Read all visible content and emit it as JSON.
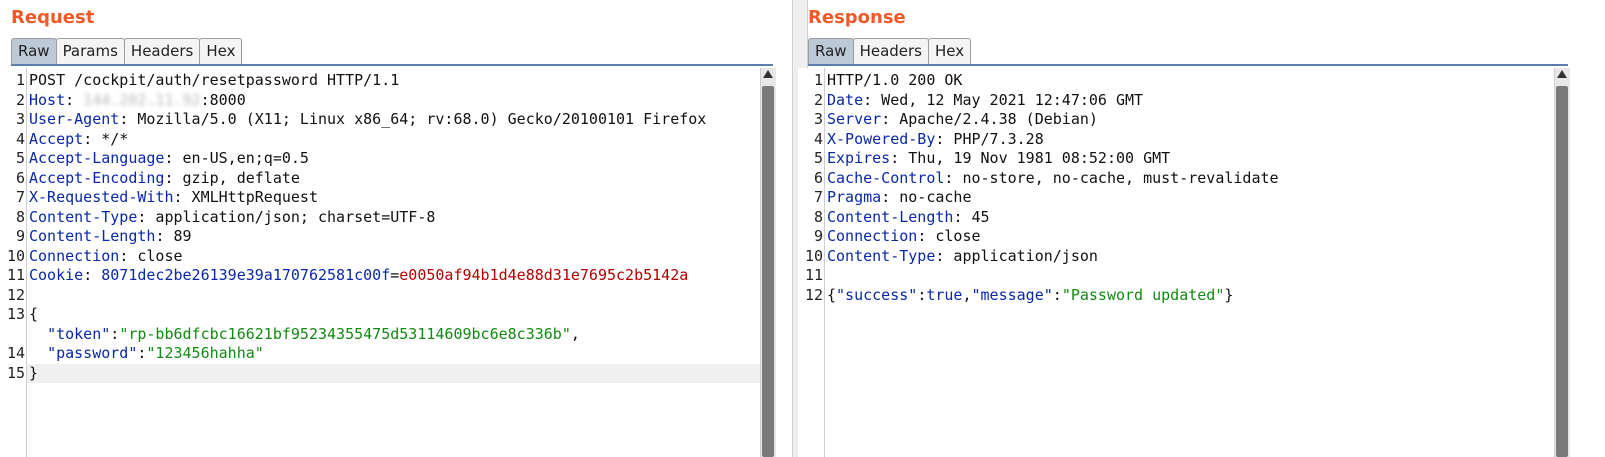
{
  "request": {
    "title": "Request",
    "tabs": [
      "Raw",
      "Params",
      "Headers",
      "Hex"
    ],
    "lines": [
      {
        "n": "1",
        "parts": [
          {
            "t": "POST /cockpit/auth/resetpassword HTTP/1.1",
            "c": ""
          }
        ]
      },
      {
        "n": "2",
        "parts": [
          {
            "t": "Host",
            "c": "k"
          },
          {
            "t": ": ",
            "c": ""
          },
          {
            "t": "144.202.11.92",
            "c": "ip"
          },
          {
            "t": ":8000",
            "c": ""
          }
        ]
      },
      {
        "n": "3",
        "parts": [
          {
            "t": "User-Agent",
            "c": "k"
          },
          {
            "t": ": Mozilla/5.0 (X11; Linux x86_64; rv:68.0) Gecko/20100101 Firefox",
            "c": ""
          }
        ]
      },
      {
        "n": "4",
        "parts": [
          {
            "t": "Accept",
            "c": "k"
          },
          {
            "t": ": */*",
            "c": ""
          }
        ]
      },
      {
        "n": "5",
        "parts": [
          {
            "t": "Accept-Language",
            "c": "k"
          },
          {
            "t": ": en-US,en;q=0.5",
            "c": ""
          }
        ]
      },
      {
        "n": "6",
        "parts": [
          {
            "t": "Accept-Encoding",
            "c": "k"
          },
          {
            "t": ": gzip, deflate",
            "c": ""
          }
        ]
      },
      {
        "n": "7",
        "parts": [
          {
            "t": "X-Requested-With",
            "c": "k"
          },
          {
            "t": ": XMLHttpRequest",
            "c": ""
          }
        ]
      },
      {
        "n": "8",
        "parts": [
          {
            "t": "Content-Type",
            "c": "k"
          },
          {
            "t": ": application/json; charset=UTF-8",
            "c": ""
          }
        ]
      },
      {
        "n": "9",
        "parts": [
          {
            "t": "Content-Length",
            "c": "k"
          },
          {
            "t": ": 89",
            "c": ""
          }
        ]
      },
      {
        "n": "10",
        "parts": [
          {
            "t": "Connection",
            "c": "k"
          },
          {
            "t": ": close",
            "c": ""
          }
        ]
      },
      {
        "n": "11",
        "parts": [
          {
            "t": "Cookie",
            "c": "k"
          },
          {
            "t": ": ",
            "c": ""
          },
          {
            "t": "8071dec2be26139e39a170762581c00f",
            "c": "k"
          },
          {
            "t": "=",
            "c": ""
          },
          {
            "t": "e0050af94b1d4e88d31e7695c2b5142a",
            "c": "cv"
          }
        ]
      },
      {
        "n": "12",
        "parts": []
      },
      {
        "n": "13",
        "parts": [
          {
            "t": "{",
            "c": ""
          }
        ]
      },
      {
        "n": "",
        "parts": [
          {
            "t": "  ",
            "c": ""
          },
          {
            "t": "\"token\"",
            "c": "k"
          },
          {
            "t": ":",
            "c": ""
          },
          {
            "t": "\"rp-bb6dfcbc16621bf95234355475d53114609bc6e8c336b\"",
            "c": "str"
          },
          {
            "t": ",",
            "c": ""
          }
        ]
      },
      {
        "n": "14",
        "parts": [
          {
            "t": "  ",
            "c": ""
          },
          {
            "t": "\"password\"",
            "c": "k"
          },
          {
            "t": ":",
            "c": ""
          },
          {
            "t": "\"123456hahha\"",
            "c": "str"
          }
        ]
      },
      {
        "n": "15",
        "parts": [
          {
            "t": "}",
            "c": ""
          }
        ]
      }
    ],
    "highlight_line": 15
  },
  "response": {
    "title": "Response",
    "tabs": [
      "Raw",
      "Headers",
      "Hex"
    ],
    "lines": [
      {
        "n": "1",
        "parts": [
          {
            "t": "HTTP/1.0 200 OK",
            "c": ""
          }
        ]
      },
      {
        "n": "2",
        "parts": [
          {
            "t": "Date",
            "c": "k"
          },
          {
            "t": ": Wed, 12 May 2021 12:47:06 GMT",
            "c": ""
          }
        ]
      },
      {
        "n": "3",
        "parts": [
          {
            "t": "Server",
            "c": "k"
          },
          {
            "t": ": Apache/2.4.38 (Debian)",
            "c": ""
          }
        ]
      },
      {
        "n": "4",
        "parts": [
          {
            "t": "X-Powered-By",
            "c": "k"
          },
          {
            "t": ": PHP/7.3.28",
            "c": ""
          }
        ]
      },
      {
        "n": "5",
        "parts": [
          {
            "t": "Expires",
            "c": "k"
          },
          {
            "t": ": Thu, 19 Nov 1981 08:52:00 GMT",
            "c": ""
          }
        ]
      },
      {
        "n": "6",
        "parts": [
          {
            "t": "Cache-Control",
            "c": "k"
          },
          {
            "t": ": no-store, no-cache, must-revalidate",
            "c": ""
          }
        ]
      },
      {
        "n": "7",
        "parts": [
          {
            "t": "Pragma",
            "c": "k"
          },
          {
            "t": ": no-cache",
            "c": ""
          }
        ]
      },
      {
        "n": "8",
        "parts": [
          {
            "t": "Content-Length",
            "c": "k"
          },
          {
            "t": ": 45",
            "c": ""
          }
        ]
      },
      {
        "n": "9",
        "parts": [
          {
            "t": "Connection",
            "c": "k"
          },
          {
            "t": ": close",
            "c": ""
          }
        ]
      },
      {
        "n": "10",
        "parts": [
          {
            "t": "Content-Type",
            "c": "k"
          },
          {
            "t": ": application/json",
            "c": ""
          }
        ]
      },
      {
        "n": "11",
        "parts": []
      },
      {
        "n": "12",
        "parts": [
          {
            "t": "{",
            "c": ""
          },
          {
            "t": "\"success\"",
            "c": "k"
          },
          {
            "t": ":",
            "c": ""
          },
          {
            "t": "true",
            "c": "k"
          },
          {
            "t": ",",
            "c": ""
          },
          {
            "t": "\"message\"",
            "c": "k"
          },
          {
            "t": ":",
            "c": ""
          },
          {
            "t": "\"Password updated\"",
            "c": "str"
          },
          {
            "t": "}",
            "c": ""
          }
        ]
      }
    ],
    "highlight_line": 1
  },
  "colors": {
    "title": "#f05a28",
    "active_tab": "#bdc9d6",
    "key": "#0a28a8",
    "string": "#118a11",
    "cookie_value": "#b00000"
  }
}
